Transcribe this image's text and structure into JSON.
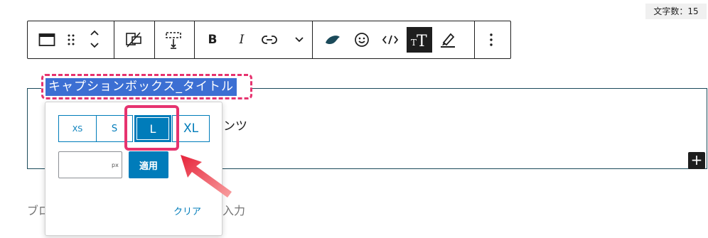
{
  "header": {
    "char_count": "文字数：15"
  },
  "toolbar": {
    "buttons": [
      {
        "name": "block-type",
        "icon": "block-icon"
      },
      {
        "name": "drag-handle",
        "icon": "drag-icon"
      },
      {
        "name": "move-updown",
        "icon": "chevron-updown-icon"
      },
      {
        "name": "device-visibility",
        "icon": "device-hide-icon"
      },
      {
        "name": "spacing",
        "icon": "spacing-icon"
      },
      {
        "name": "bold",
        "label": "B"
      },
      {
        "name": "italic",
        "label": "I"
      },
      {
        "name": "link",
        "icon": "link-icon"
      },
      {
        "name": "more-formats",
        "icon": "chevron-down-icon"
      },
      {
        "name": "swell-icon",
        "icon": "swell-leaf-icon"
      },
      {
        "name": "emoji",
        "icon": "smiley-icon"
      },
      {
        "name": "inline-code",
        "icon": "code-icon"
      },
      {
        "name": "font-size",
        "icon": "font-size-icon"
      },
      {
        "name": "marker",
        "icon": "marker-icon"
      },
      {
        "name": "options",
        "icon": "vertical-ellipsis-icon"
      }
    ],
    "bold_label": "B",
    "italic_label": "I",
    "active_color": "#1e1e1e"
  },
  "caption_box": {
    "title": "キャプションボックス_タイトル",
    "content_tail": "ンツ",
    "add_label": "+",
    "title_bg": "#3c6fd3",
    "highlight_color": "#e6336f"
  },
  "paragraph": {
    "placeholder_start": "ブロ",
    "placeholder_end": "入力"
  },
  "popover": {
    "sizes": [
      {
        "label": "XS",
        "selected": false
      },
      {
        "label": "S",
        "selected": false
      },
      {
        "label": "L",
        "selected": true
      },
      {
        "label": "XL",
        "selected": false
      }
    ],
    "unit": "px",
    "input_value": "",
    "apply_label": "適用",
    "clear_label": "クリア",
    "accent": "#007cba"
  }
}
